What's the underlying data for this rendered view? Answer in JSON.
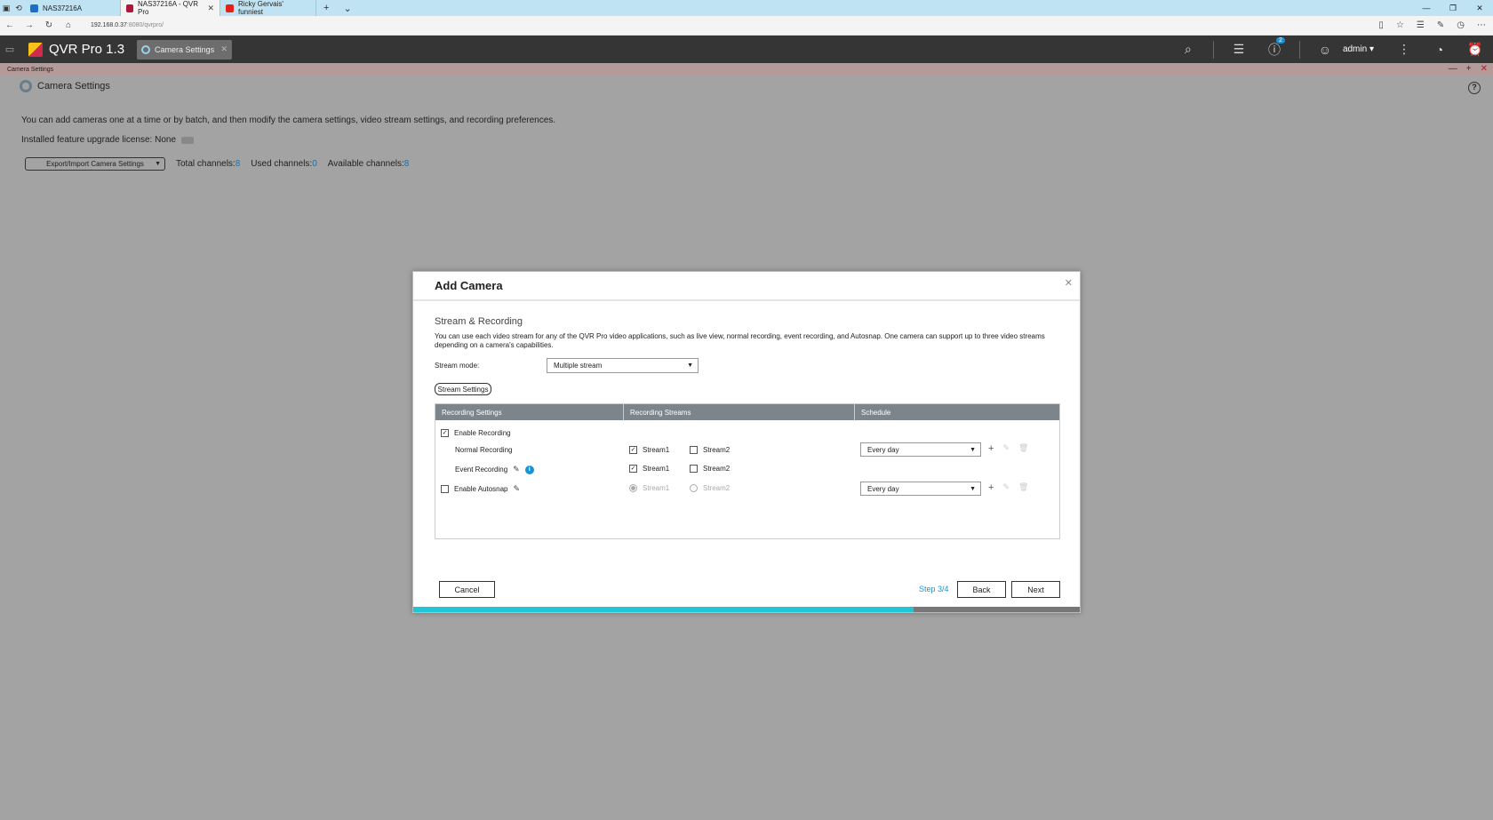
{
  "browser": {
    "tabs": [
      {
        "label": "NAS37216A",
        "color": "#1f6fbf"
      },
      {
        "label": "NAS37216A - QVR Pro",
        "color": "#b1153a"
      },
      {
        "label": "Ricky Gervais' funniest",
        "color": "#e62117"
      }
    ],
    "url_host": "192.168.0.37",
    "url_rest": ":8080/qvrpro/"
  },
  "app": {
    "title": "QVR Pro 1.3",
    "open_tab": "Camera Settings",
    "notifications_count": "2",
    "user": "admin"
  },
  "window": {
    "title": "Camera Settings"
  },
  "page": {
    "title": "Camera Settings",
    "intro": "You can add cameras one at a time or by batch, and then modify the camera settings, video stream settings, and recording preferences.",
    "license_label": "Installed feature upgrade license: None",
    "export_button": "Export/Import Camera Settings",
    "total_label": "Total channels:",
    "total_value": "8",
    "used_label": "Used channels:",
    "used_value": "0",
    "available_label": "Available channels:",
    "available_value": "8"
  },
  "modal": {
    "title": "Add Camera",
    "section": "Stream & Recording",
    "description": "You can use each video stream for any of the QVR Pro video applications, such as live view, normal recording, event recording, and Autosnap. One camera can support up to three video streams depending on a camera's capabilities.",
    "stream_mode_label": "Stream mode:",
    "stream_mode_value": "Multiple stream",
    "stream_settings_button": "Stream Settings",
    "columns": [
      "Recording Settings",
      "Recording Streams",
      "Schedule"
    ],
    "enable_recording": "Enable Recording",
    "normal_recording": "Normal Recording",
    "event_recording": "Event Recording",
    "enable_autosnap": "Enable Autosnap",
    "stream1": "Stream1",
    "stream2": "Stream2",
    "schedule_value": "Every day",
    "cancel": "Cancel",
    "step": "Step 3/4",
    "back": "Back",
    "next": "Next",
    "progress": 0.75
  }
}
